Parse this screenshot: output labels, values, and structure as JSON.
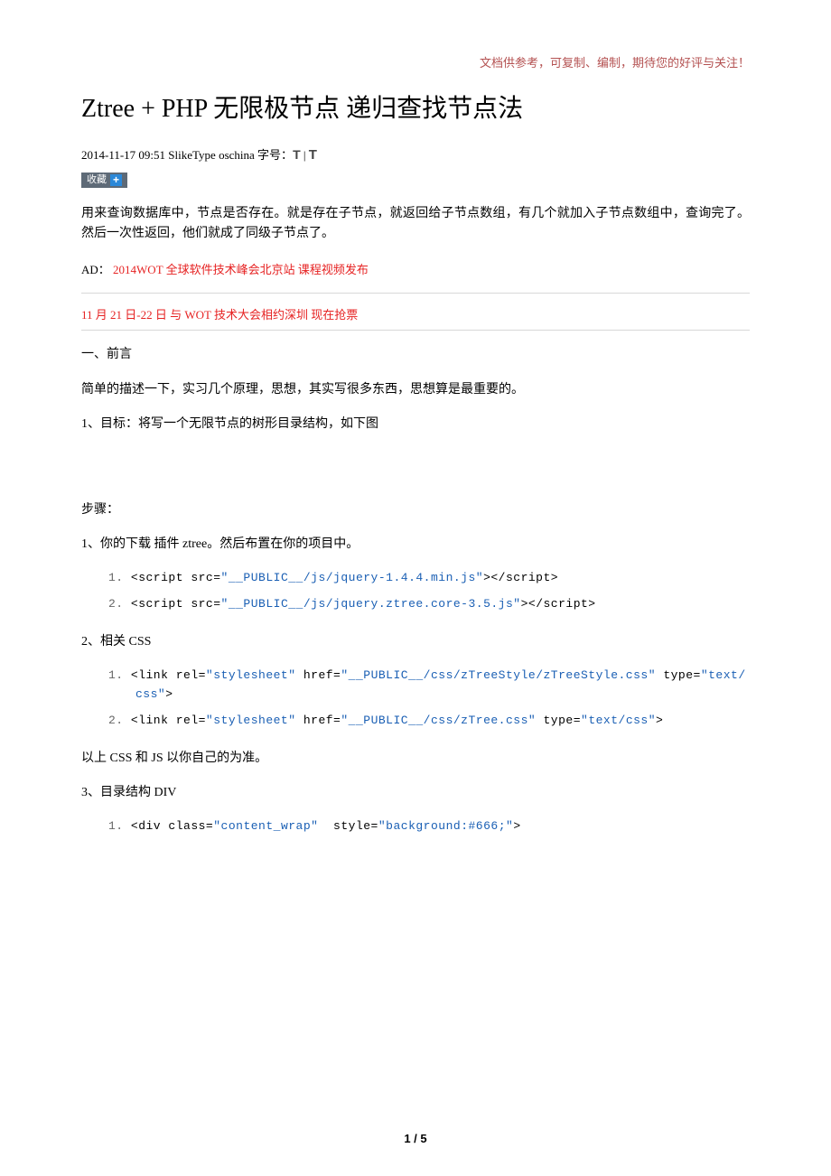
{
  "header_note": "文档供参考，可复制、编制，期待您的好评与关注！",
  "title": "Ztree + PHP 无限极节点 递归查找节点法",
  "meta": {
    "datetime": "2014-11-17 09:51",
    "author": "SlikeType",
    "source": "oschina",
    "font_label": "字号：",
    "pipe": "|"
  },
  "buttons": {
    "favorite_label": "收藏",
    "plus": "+"
  },
  "summary": "用来查询数据库中，节点是否存在。就是存在子节点，就返回给子节点数组，有几个就加入子节点数组中，查询完了。然后一次性返回，他们就成了同级子节点了。",
  "ad": {
    "label": "AD：",
    "link1": "2014WOT 全球软件技术峰会北京站 课程视频发布",
    "link2": "11 月 21 日-22 日 与 WOT 技术大会相约深圳 现在抢票"
  },
  "sections": {
    "s1": "一、前言",
    "s1_body": "简单的描述一下，实习几个原理，思想，其实写很多东西，思想算是最重要的。",
    "s2": "1、目标：将写一个无限节点的树形目录结构，如下图",
    "steps_label": "步骤：",
    "step1": "1、你的下载 插件   ztree。然后布置在你的项目中。",
    "step2_label": "2、相关 CSS",
    "step2_note": "以上 CSS 和 JS 以你自己的为准。",
    "step3_label": "3、目录结构 DIV"
  },
  "code": {
    "js": [
      {
        "n": "1.",
        "parts": [
          [
            "tag",
            "<script src="
          ],
          [
            "str",
            "\"__PUBLIC__/js/jquery-1.4.4.min.js\""
          ],
          [
            "tag",
            "></script>"
          ]
        ]
      },
      {
        "n": "2.",
        "parts": [
          [
            "tag",
            "<script src="
          ],
          [
            "str",
            "\"__PUBLIC__/js/jquery.ztree.core-3.5.js\""
          ],
          [
            "tag",
            "></script>"
          ]
        ]
      }
    ],
    "css": [
      {
        "n": "1.",
        "parts": [
          [
            "tag",
            "<link rel="
          ],
          [
            "str",
            "\"stylesheet\""
          ],
          [
            "tag",
            " href="
          ],
          [
            "str",
            "\"__PUBLIC__/css/zTreeStyle/zTreeStyle.css\""
          ],
          [
            "tag",
            " type="
          ],
          [
            "str",
            "\"text/css\""
          ],
          [
            "tag",
            ">"
          ]
        ]
      },
      {
        "n": "2.",
        "parts": [
          [
            "tag",
            "<link rel="
          ],
          [
            "str",
            "\"stylesheet\""
          ],
          [
            "tag",
            " href="
          ],
          [
            "str",
            "\"__PUBLIC__/css/zTree.css\""
          ],
          [
            "tag",
            " type="
          ],
          [
            "str",
            "\"text/css\""
          ],
          [
            "tag",
            ">"
          ]
        ]
      }
    ],
    "div": [
      {
        "n": "1.",
        "parts": [
          [
            "tag",
            "<div class="
          ],
          [
            "str",
            "\"content_wrap\""
          ],
          [
            "tag",
            "  style="
          ],
          [
            "str",
            "\"background:#666;\""
          ],
          [
            "tag",
            ">"
          ]
        ]
      }
    ]
  },
  "page_number": "1 / 5"
}
